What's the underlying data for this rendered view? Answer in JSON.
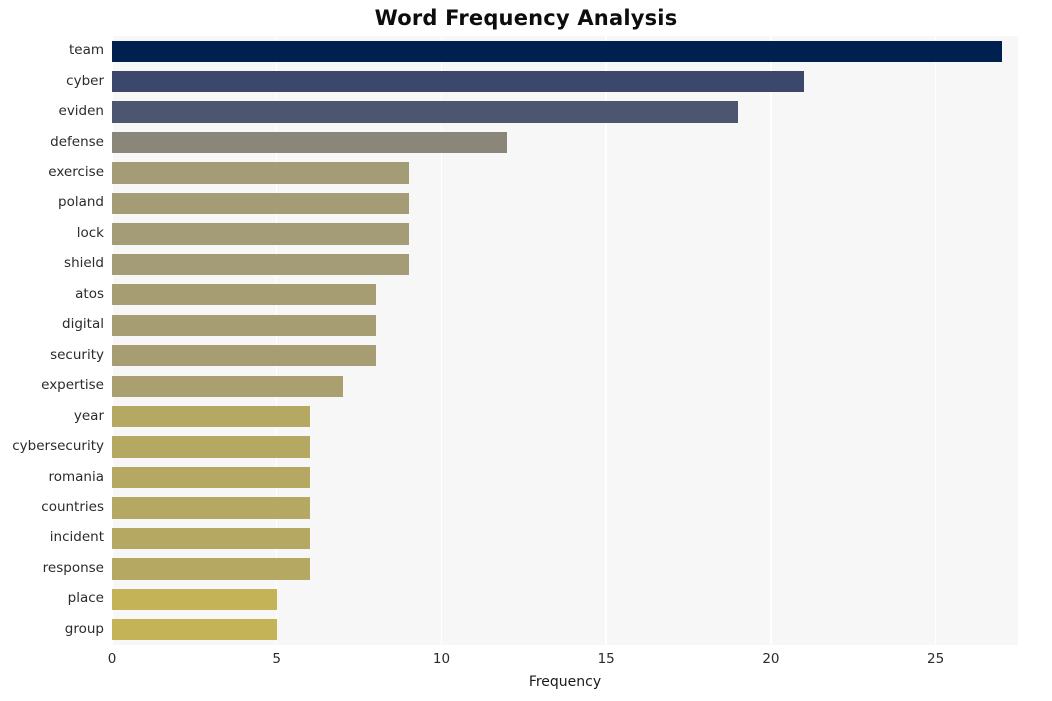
{
  "chart_data": {
    "type": "bar",
    "orientation": "horizontal",
    "title": "Word Frequency Analysis",
    "xlabel": "Frequency",
    "ylabel": "",
    "xlim": [
      0,
      27.5
    ],
    "xticks": [
      0,
      5,
      10,
      15,
      20,
      25
    ],
    "xtick_labels": [
      "0",
      "5",
      "10",
      "15",
      "20",
      "25"
    ],
    "grid": "vertical-white-on-light-gray",
    "legend": "none",
    "categories": [
      "team",
      "cyber",
      "eviden",
      "defense",
      "exercise",
      "poland",
      "lock",
      "shield",
      "atos",
      "digital",
      "security",
      "expertise",
      "year",
      "cybersecurity",
      "romania",
      "countries",
      "incident",
      "response",
      "place",
      "group"
    ],
    "values": [
      27,
      21,
      19,
      12,
      9,
      9,
      9,
      9,
      8,
      8,
      8,
      7,
      6,
      6,
      6,
      6,
      6,
      6,
      5,
      5
    ],
    "bar_colors": [
      "#002050",
      "#3c486b",
      "#4d5670",
      "#8a8679",
      "#a39c76",
      "#a39c76",
      "#a39c76",
      "#a39c76",
      "#a69d72",
      "#a69d72",
      "#a69d72",
      "#aa9f6e",
      "#b5a863",
      "#b5a863",
      "#b5a863",
      "#b5a863",
      "#b5a863",
      "#b5a863",
      "#c4b457",
      "#c4b457"
    ],
    "plot_background": "#f7f7f7",
    "figure_background": "#ffffff",
    "gridline_color": "#ffffff"
  },
  "axis": {
    "x_title": "Frequency"
  }
}
